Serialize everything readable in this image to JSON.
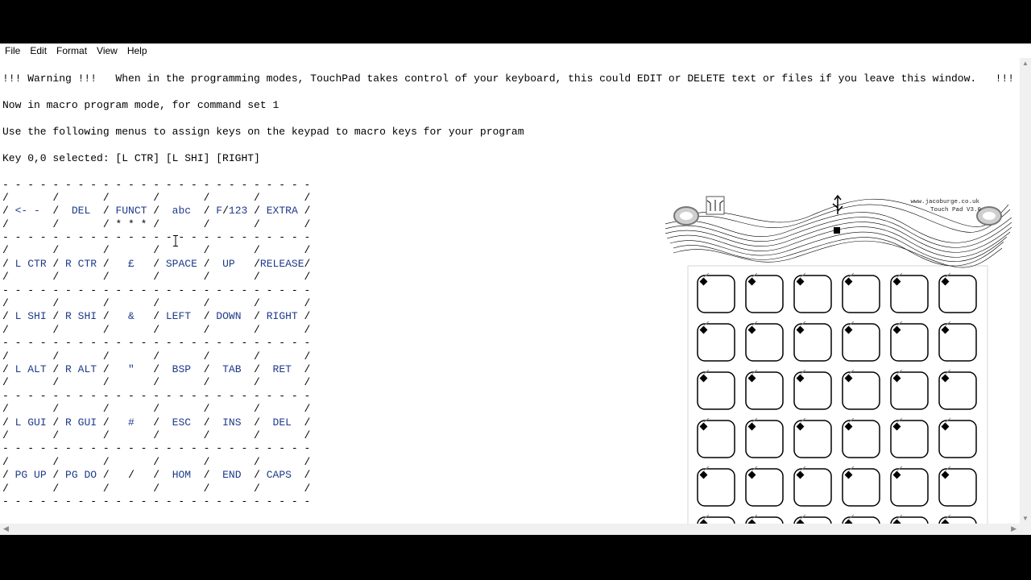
{
  "menu": [
    "File",
    "Edit",
    "Format",
    "View",
    "Help"
  ],
  "lines": [
    "",
    "!!! Warning !!!   When in the programming modes, TouchPad takes control of your keyboard, this could EDIT or DELETE text or files if you leave this window.   !!! Warning !!!",
    "",
    "Now in macro program mode, for command set 1",
    "",
    "Use the following menus to assign keys on the keypad to macro keys for your program",
    "",
    "Key 0,0 selected: [L CTR] [L SHI] [RIGHT]",
    "",
    "- - - - - - - - - - - - - - - - - - - - - - - - -",
    "/       /       /       /       /       /       /",
    "/ <- -  /  DEL  / FUNCT /  abc  / F/123 / EXTRA /",
    "/       /       / * * * /       /       /       /",
    "- - - - - - - - - - - - - - - - - - - - - - - - -",
    "/       /       /       /       /       /       /",
    "/ L CTR / R CTR /   £   / SPACE /  UP   /RELEASE/",
    "/       /       /       /       /       /       /",
    "- - - - - - - - - - - - - - - - - - - - - - - - -",
    "/       /       /       /       /       /       /",
    "/ L SHI / R SHI /   &   / LEFT  / DOWN  / RIGHT /",
    "/       /       /       /       /       /       /",
    "- - - - - - - - - - - - - - - - - - - - - - - - -",
    "/       /       /       /       /       /       /",
    "/ L ALT / R ALT /   \"   /  BSP  /  TAB  /  RET  /",
    "/       /       /       /       /       /       /",
    "- - - - - - - - - - - - - - - - - - - - - - - - -",
    "/       /       /       /       /       /       /",
    "/ L GUI / R GUI /   #   /  ESC  /  INS  /  DEL  /",
    "/       /       /       /       /       /       /",
    "- - - - - - - - - - - - - - - - - - - - - - - - -",
    "/       /       /       /       /       /       /",
    "/ PG UP / PG DO /   /   /  HOM  /  END  / CAPS  /",
    "/       /       /       /       /       /       /",
    "- - - - - - - - - - - - - - - - - - - - - - - - -"
  ],
  "pad": {
    "website": "www.jacoburge.co.uk",
    "model": "Touch Pad V3.0",
    "selected_key_mark": "X",
    "rows": 6,
    "cols": 6,
    "accent_color": "#29a3e6"
  }
}
